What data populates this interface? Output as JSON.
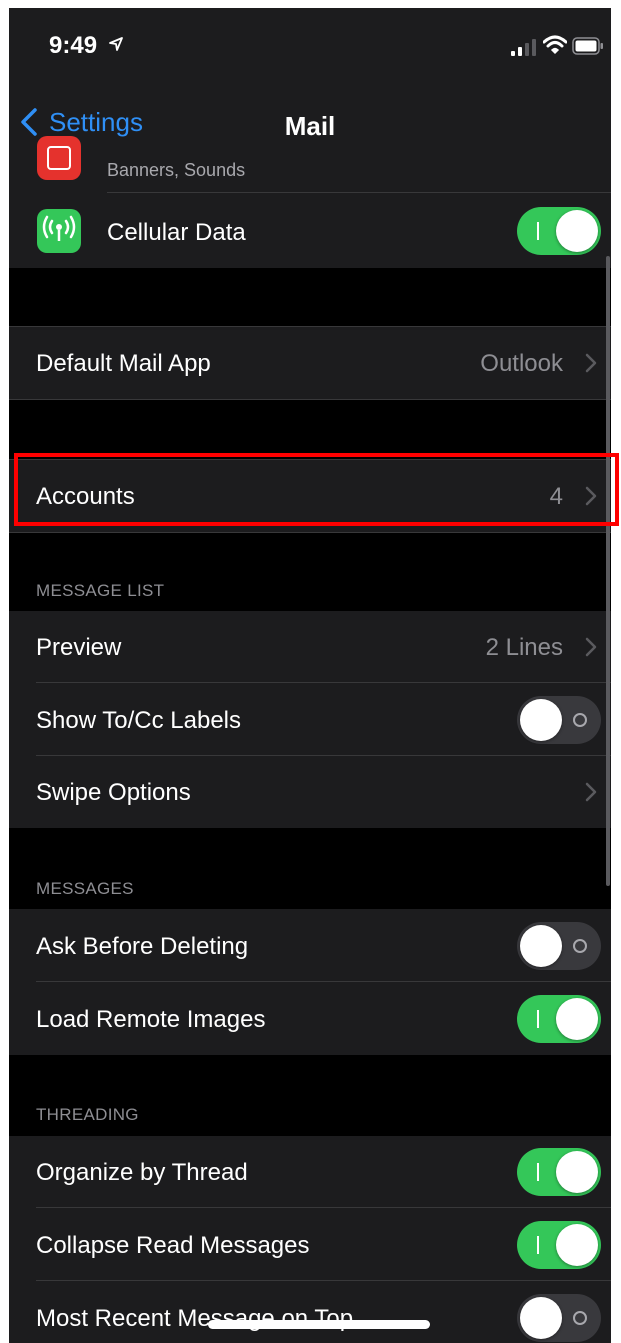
{
  "status_bar": {
    "time": "9:49"
  },
  "nav": {
    "back_label": "Settings",
    "title": "Mail"
  },
  "notifications_row": {
    "subtitle": "Banners, Sounds"
  },
  "cellular_row": {
    "label": "Cellular Data",
    "on": true
  },
  "default_mail_row": {
    "label": "Default Mail App",
    "value": "Outlook"
  },
  "accounts_row": {
    "label": "Accounts",
    "value": "4"
  },
  "message_list": {
    "header": "MESSAGE LIST",
    "preview": {
      "label": "Preview",
      "value": "2 Lines"
    },
    "show_tocc": {
      "label": "Show To/Cc Labels",
      "on": false
    },
    "swipe": {
      "label": "Swipe Options"
    }
  },
  "messages": {
    "header": "MESSAGES",
    "ask_delete": {
      "label": "Ask Before Deleting",
      "on": false
    },
    "load_images": {
      "label": "Load Remote Images",
      "on": true
    }
  },
  "threading": {
    "header": "THREADING",
    "organize": {
      "label": "Organize by Thread",
      "on": true
    },
    "collapse": {
      "label": "Collapse Read Messages",
      "on": true
    },
    "recent_top": {
      "label": "Most Recent Message on Top",
      "on": false
    }
  },
  "colors": {
    "toggle_on": "#34c759",
    "toggle_off": "#39393d",
    "accent": "#2f8ff5",
    "highlight": "#ff0000"
  },
  "icons": [
    "location-arrow-icon",
    "signal-icon",
    "wifi-icon",
    "battery-icon",
    "back-chevron-icon",
    "notifications-icon",
    "cellular-antenna-icon",
    "chevron-right-icon"
  ]
}
